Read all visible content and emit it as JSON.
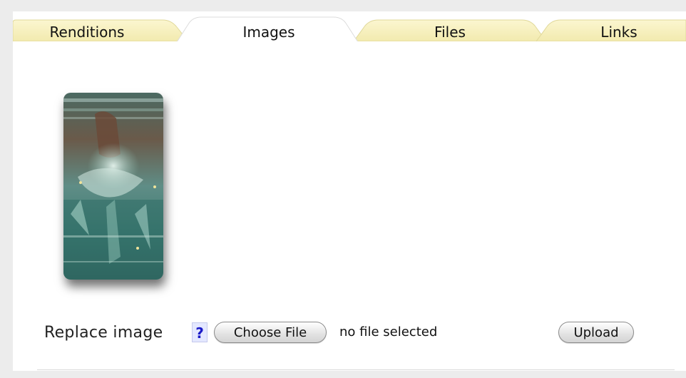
{
  "tabs": [
    {
      "label": "Renditions",
      "active": false
    },
    {
      "label": "Images",
      "active": true
    },
    {
      "label": "Files",
      "active": false
    },
    {
      "label": "Links",
      "active": false
    }
  ],
  "colors": {
    "tab_inactive": "#f7f1bf",
    "tab_active": "#ffffff",
    "page_background": "#ececec",
    "help_text": "#1a1ac8"
  },
  "image_preview": {
    "icon": "image-thumbnail"
  },
  "replace": {
    "label": "Replace image",
    "help": "?",
    "choose_button": "Choose File",
    "file_status": "no file selected",
    "upload_button": "Upload"
  }
}
